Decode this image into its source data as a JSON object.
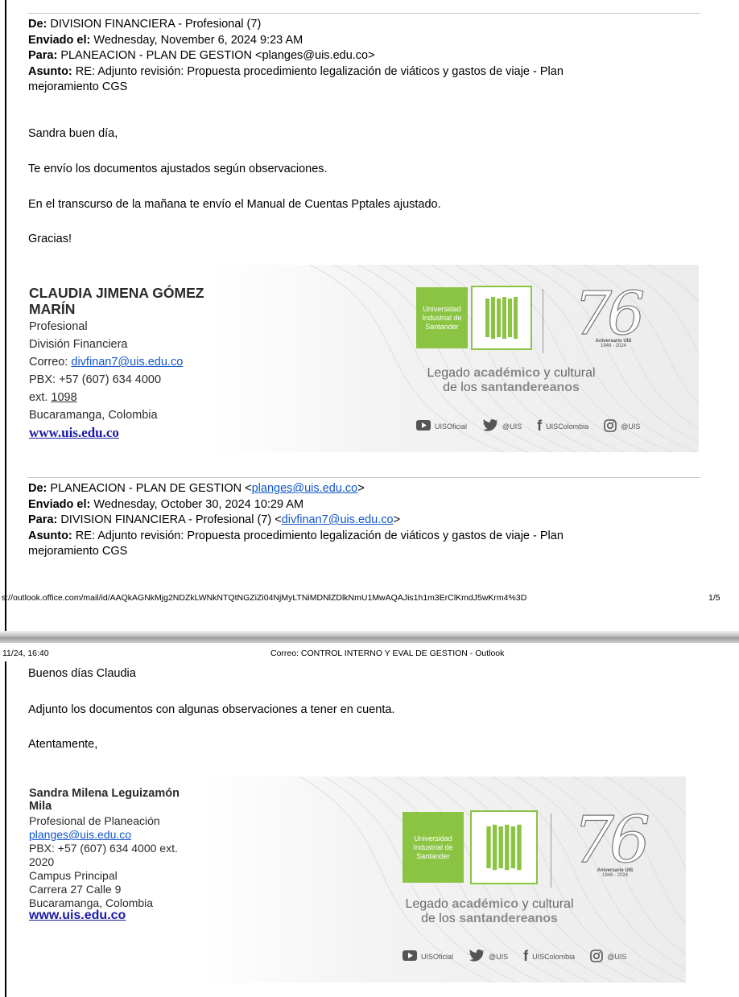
{
  "message1": {
    "from_label": "De:",
    "from_value": "DIVISION FINANCIERA - Profesional (7)",
    "sent_label": "Enviado el:",
    "sent_value": "Wednesday, November 6, 2024 9:23 AM",
    "to_label": "Para:",
    "to_value": "PLANEACION - PLAN DE GESTION <planges@uis.edu.co>",
    "subject_label": "Asunto:",
    "subject_line1": "RE: Adjunto revisión: Propuesta procedimiento legalización de viáticos y gastos de viaje - Plan",
    "subject_line2": "mejoramiento CGS",
    "body": [
      "Sandra buen día,",
      "Te envío los documentos ajustados según observaciones.",
      "En el transcurso de la mañana te envío el Manual de Cuentas Pptales ajustado.",
      "Gracias!"
    ],
    "signature": {
      "name_line1": "CLAUDIA JIMENA GÓMEZ",
      "name_line2": "MARÍN",
      "title": "Profesional",
      "department": "División Financiera",
      "email_label": "Correo:",
      "email": "divfinan7@uis.edu.co",
      "pbx": "PBX:  +57  (607)  634  4000",
      "ext_label": "ext.",
      "ext": "1098",
      "city": "Bucaramanga, Colombia",
      "website": "www.uis.edu.co"
    }
  },
  "message2": {
    "from_label": "De:",
    "from_value": "PLANEACION - PLAN DE GESTION <",
    "from_link": "planges@uis.edu.co",
    "from_close": ">",
    "sent_label": "Enviado el:",
    "sent_value": "Wednesday, October 30, 2024 10:29 AM",
    "to_label": "Para:",
    "to_value": "DIVISION FINANCIERA - Profesional (7) <",
    "to_link": "divfinan7@uis.edu.co",
    "to_close": ">",
    "subject_label": "Asunto:",
    "subject_line1": "RE: Adjunto revisión: Propuesta procedimiento legalización de viáticos y gastos de viaje - Plan",
    "subject_line2": "mejoramiento CGS",
    "body": [
      "Buenos días Claudia",
      "Adjunto los documentos con algunas observaciones a tener en cuenta.",
      "Atentamente,"
    ],
    "signature": {
      "name_line1": "Sandra Milena Leguizamón",
      "name_line2": "Mila",
      "title": "Profesional de Planeación",
      "email": "planges@uis.edu.co",
      "pbx": "PBX: +57 (607) 634 4000 ext.",
      "ext": "2020",
      "campus": "Campus Principal",
      "address": "Carrera 27 Calle 9",
      "city": "Bucaramanga, Colombia",
      "website": "www.uis.edu.co"
    }
  },
  "banner": {
    "university": "Universidad Industrial de Santander",
    "uni_line1": "Universidad",
    "uni_line2": "Industrial de",
    "uni_line3": "Santander",
    "anniversary_number": "76",
    "anniversary_line1": "Aniversario UIS",
    "anniversary_line2": "1948 - 2024",
    "legado_prefix": "Legado ",
    "legado_bold": "académico",
    "legado_suffix": " y cultural",
    "legado_line2_prefix": "de los ",
    "legado_line2_bold": "santandereanos",
    "social": [
      "UISOficial",
      "@UIS",
      "UISColombia",
      "@UIS"
    ],
    "green": "#8bc443"
  },
  "print_footer": {
    "url": "s://outlook.office.com/mail/id/AAQkAGNkMjg2NDZkLWNkNTQtNGZiZi04NjMyLTNiMDNlZDlkNmU1MwAQAJis1h1m3ErClKmdJ5wKrm4%3D",
    "page": "1/5"
  },
  "print_header": {
    "datetime": "11/24, 16:40",
    "title": "Correo: CONTROL INTERNO Y EVAL DE GESTION - Outlook"
  }
}
